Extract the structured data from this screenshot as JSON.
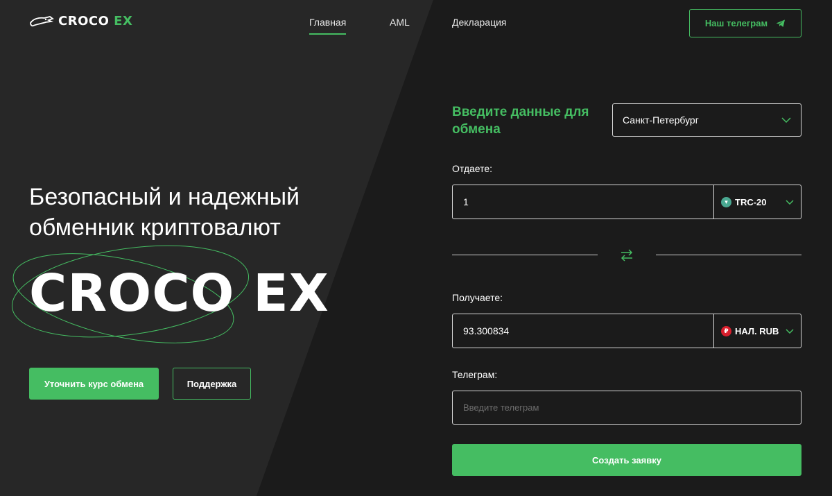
{
  "header": {
    "brand_main": "CROCO",
    "brand_accent": "EX",
    "nav": [
      {
        "label": "Главная",
        "active": true
      },
      {
        "label": "AML",
        "active": false
      },
      {
        "label": "Декларация",
        "active": false
      }
    ],
    "telegram_button": "Наш телеграм"
  },
  "hero": {
    "title": "Безопасный и надежный обменник криптовалют",
    "brand": "CROCO EX",
    "primary_button": "Уточнить курс обмена",
    "secondary_button": "Поддержка"
  },
  "form": {
    "title": "Введите данные для обмена",
    "city": "Санкт-Петербург",
    "give_label": "Отдаете:",
    "give_value": "1",
    "give_currency": "TRC-20",
    "get_label": "Получаете:",
    "get_value": "93.300834",
    "get_currency": "НАЛ. RUB",
    "telegram_label": "Телеграм:",
    "telegram_placeholder": "Введите телеграм",
    "submit": "Создать заявку"
  },
  "icons": {
    "logo": "crocodile-logo-icon",
    "telegram": "telegram-plane-icon",
    "chevron": "chevron-down-icon",
    "swap": "swap-arrows-icon",
    "tron": "tron-coin-icon",
    "ruble": "ruble-coin-icon"
  },
  "colors": {
    "accent": "#45bd62",
    "background_left": "#272727",
    "background_right": "#1b1b1b"
  }
}
